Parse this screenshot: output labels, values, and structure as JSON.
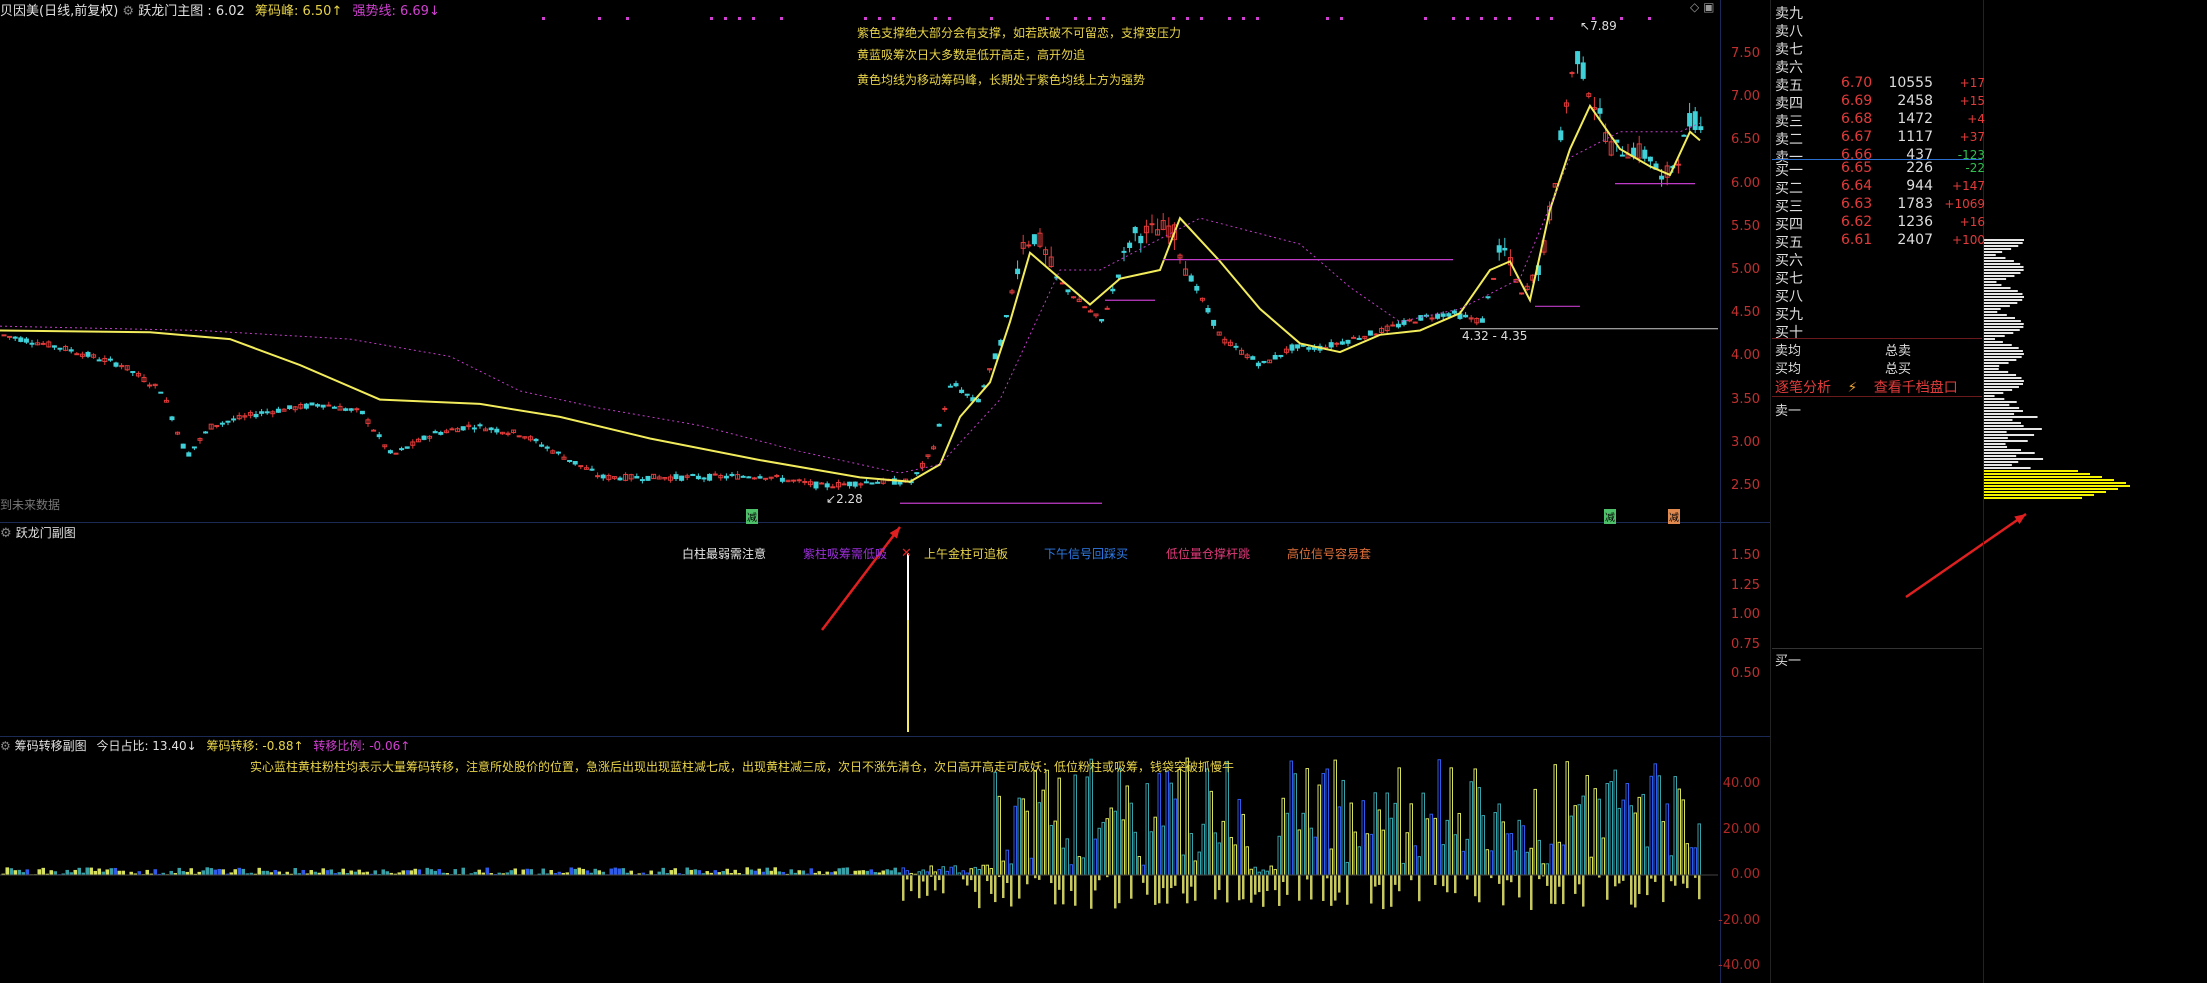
{
  "main_header": {
    "title": "贝因美(日线,前复权)",
    "indicator": "跃龙门主图",
    "value1_label": ": 6.02",
    "chip_peak": "筹码峰: 6.50↑",
    "strong_line": "强势线: 6.69↓"
  },
  "main_notes": [
    "紫色支撑绝大部分会有支撑，如若跌破不可留恋，支撑变压力",
    "黄蓝吸筹次日大多数是低开高走，高开勿追",
    "黄色均线为移动筹码峰，长期处于紫色均线上方为强势"
  ],
  "main_annotations": {
    "high_label": "7.89",
    "low_label": "2.28",
    "range_label": "4.32 - 4.35",
    "future_label": "到未来数据",
    "marker_a": "减",
    "marker_b": "减",
    "marker_c": "减"
  },
  "price_axis": [
    "7.50",
    "7.00",
    "6.50",
    "6.00",
    "5.50",
    "5.00",
    "4.50",
    "4.00",
    "3.50",
    "3.00",
    "2.50"
  ],
  "sub1": {
    "title": "跃龙门副图",
    "legend": [
      {
        "text": "白柱最弱需注意",
        "color": "#e6e6e6"
      },
      {
        "text": "紫柱吸筹需低吸",
        "color": "#9a2fd8"
      },
      {
        "text": "上午金柱可追板",
        "color": "#e8d44a"
      },
      {
        "text": "下午信号回踩买",
        "color": "#2f7be8"
      },
      {
        "text": "低位量仓撑杆跳",
        "color": "#e03a7a"
      },
      {
        "text": "高位信号容易套",
        "color": "#e0703a"
      }
    ],
    "axis": [
      "1.50",
      "1.25",
      "1.00",
      "0.75",
      "0.50"
    ]
  },
  "sub2": {
    "title": "筹码转移副图",
    "today_ratio": "今日占比: 13.40↓",
    "chip_transfer": "筹码转移: -0.88↑",
    "transfer_ratio": "转移比例: -0.06↑",
    "note": "实心蓝柱黄柱粉柱均表示大量筹码转移，注意所处股价的位置，急涨后出现出现蓝柱减七成，出现黄柱减三成，次日不涨先清仓，次日高开高走可成妖；低位粉柱或吸筹，钱袋突破抓慢牛",
    "axis": [
      "40.00",
      "20.00",
      "0.00",
      "-20.00",
      "-40.00"
    ]
  },
  "orderbook": {
    "sells": [
      {
        "name": "卖九",
        "price": "",
        "vol": "",
        "chg": ""
      },
      {
        "name": "卖八",
        "price": "",
        "vol": "",
        "chg": ""
      },
      {
        "name": "卖七",
        "price": "",
        "vol": "",
        "chg": ""
      },
      {
        "name": "卖六",
        "price": "",
        "vol": "",
        "chg": ""
      },
      {
        "name": "卖五",
        "price": "6.70",
        "vol": "10555",
        "chg": "+17"
      },
      {
        "name": "卖四",
        "price": "6.69",
        "vol": "2458",
        "chg": "+15"
      },
      {
        "name": "卖三",
        "price": "6.68",
        "vol": "1472",
        "chg": "+4"
      },
      {
        "name": "卖二",
        "price": "6.67",
        "vol": "1117",
        "chg": "+37"
      },
      {
        "name": "卖一",
        "price": "6.66",
        "vol": "437",
        "chg": "-123"
      }
    ],
    "buys": [
      {
        "name": "买一",
        "price": "6.65",
        "vol": "226",
        "chg": "-22"
      },
      {
        "name": "买二",
        "price": "6.64",
        "vol": "944",
        "chg": "+147"
      },
      {
        "name": "买三",
        "price": "6.63",
        "vol": "1783",
        "chg": "+1069"
      },
      {
        "name": "买四",
        "price": "6.62",
        "vol": "1236",
        "chg": "+16"
      },
      {
        "name": "买五",
        "price": "6.61",
        "vol": "2407",
        "chg": "+100"
      },
      {
        "name": "买六",
        "price": "",
        "vol": "",
        "chg": ""
      },
      {
        "name": "买七",
        "price": "",
        "vol": "",
        "chg": ""
      },
      {
        "name": "买八",
        "price": "",
        "vol": "",
        "chg": ""
      },
      {
        "name": "买九",
        "price": "",
        "vol": "",
        "chg": ""
      },
      {
        "name": "买十",
        "price": "",
        "vol": "",
        "chg": ""
      }
    ],
    "avg_sell": "卖均",
    "total_sell": "总卖",
    "avg_buy": "买均",
    "total_buy": "总买",
    "tick_analysis": "逐笔分析",
    "view_depth": "查看千档盘口",
    "sell_one_label": "卖一",
    "buy_one_label": "买一"
  },
  "colors": {
    "up": "#e23b3b",
    "down": "#3fd0d8",
    "ma_yellow": "#f2ec5c",
    "purple": "#c03cc8",
    "arrow": "#e02020",
    "chip_yellow": "#f2f200"
  }
}
